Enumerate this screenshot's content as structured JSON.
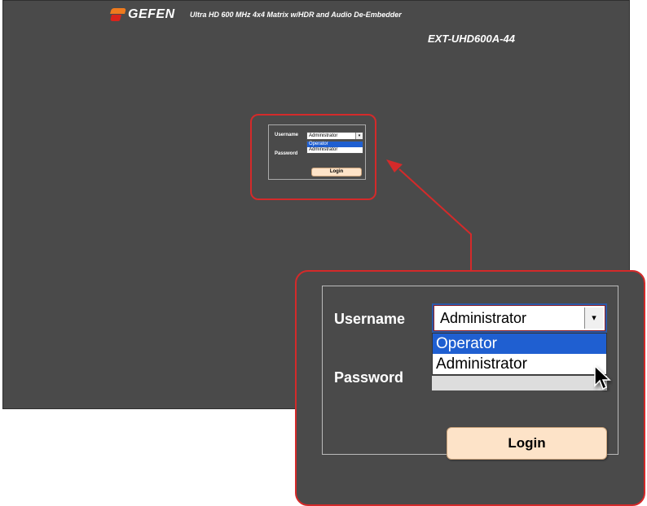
{
  "header": {
    "brand": "GEFEN",
    "subtitle": "Ultra HD 600 MHz 4x4 Matrix w/HDR and Audio De-Embedder",
    "model": "EXT-UHD600A-44"
  },
  "login": {
    "username_label": "Username",
    "password_label": "Password",
    "selected_user": "Administrator",
    "dropdown_arrow": "▾",
    "options": [
      "Operator",
      "Administrator"
    ],
    "highlighted_option": "Operator",
    "login_button": "Login"
  },
  "colors": {
    "background": "#4a4a4a",
    "highlight": "#1f5fd1",
    "callout_border": "#d42a2a",
    "login_button": "#fde3c8"
  },
  "icons": {
    "logo": "gefen-logo-icon",
    "cursor": "mouse-pointer-icon",
    "dropdown": "chevron-down-icon"
  }
}
